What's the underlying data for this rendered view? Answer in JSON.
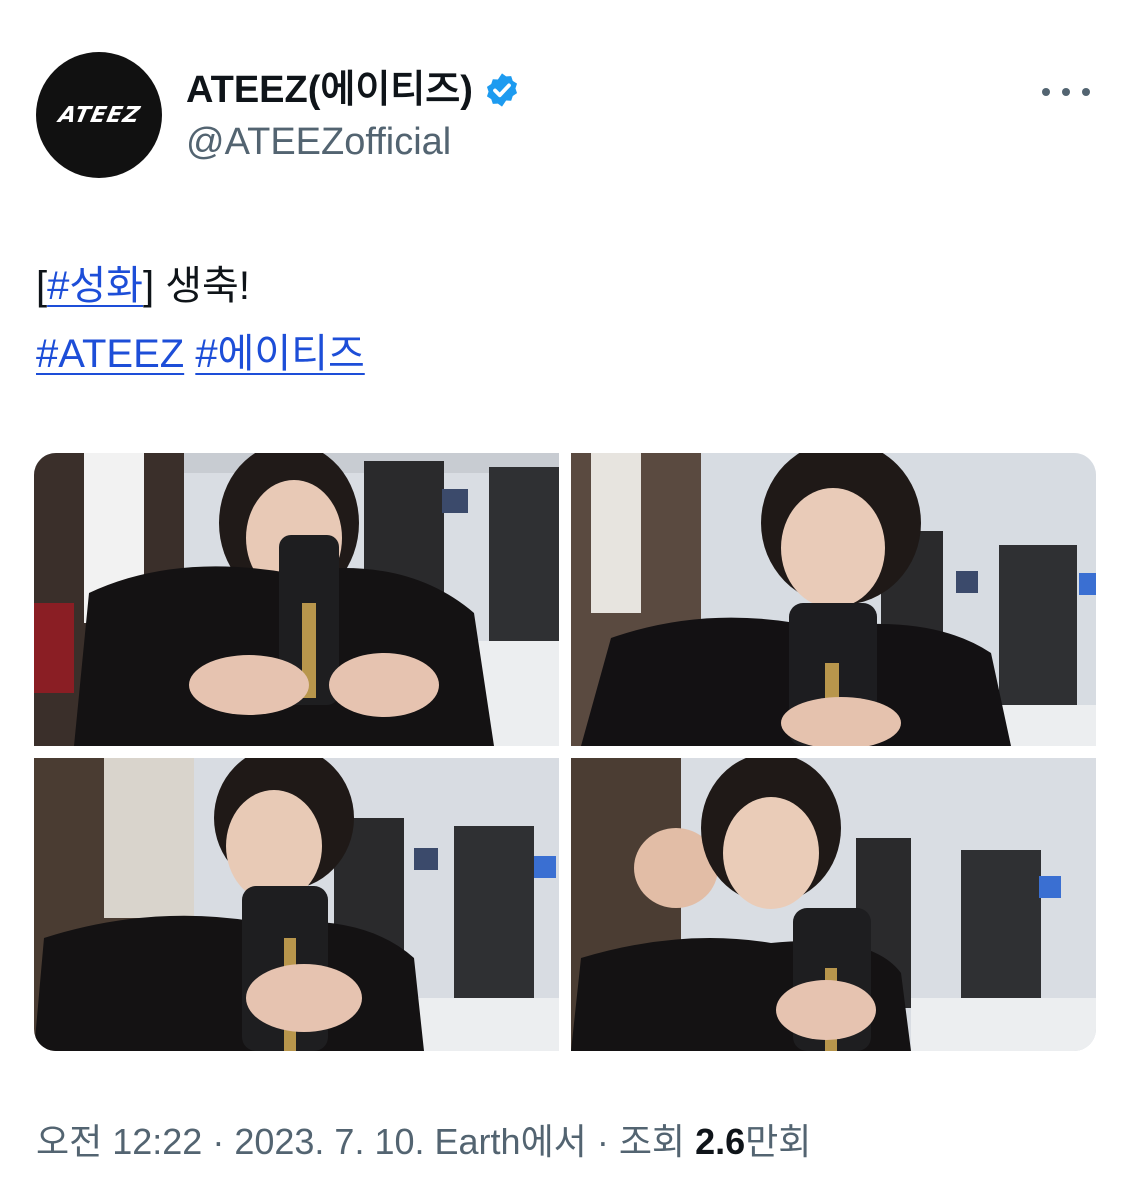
{
  "author": {
    "display_name": "ATEEZ(에이티즈)",
    "handle": "@ATEEZofficial",
    "avatar_logo": "ATEEZ",
    "verified": true,
    "verified_color": "#1d9bf0"
  },
  "more_icon": "more-horizontal-icon",
  "tweet": {
    "line1": {
      "open_bracket": "[",
      "hashtag": "#성화",
      "close_bracket": "]",
      "text": " 생축!"
    },
    "line2": {
      "hashtag1": "#ATEEZ",
      "hashtag2": "#에이티즈"
    }
  },
  "media": {
    "count": 4
  },
  "meta": {
    "time": "오전 12:22",
    "sep1": " · ",
    "date": "2023. 7. 10.",
    "source": " Earth에서",
    "sep2": " · ",
    "views_label": "조회 ",
    "views_number": "2.6",
    "views_unit": "만회"
  },
  "colors": {
    "link": "#1d4ed8",
    "secondary_text": "#536471",
    "primary_text": "#0f1419"
  }
}
